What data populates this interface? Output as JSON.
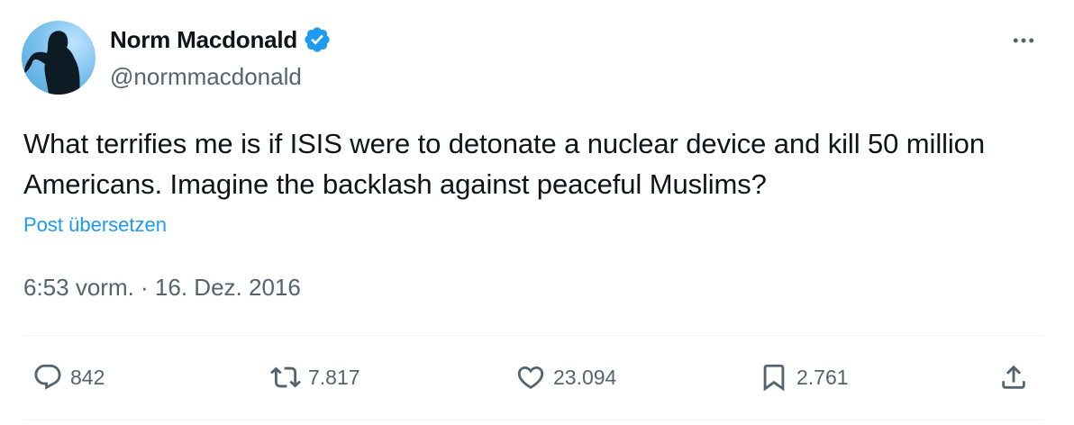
{
  "author": {
    "display_name": "Norm Macdonald",
    "handle": "@normmacdonald",
    "verified": true
  },
  "tweet": {
    "text": "What terrifies me is if ISIS were to detonate a nuclear device and kill 50 million Americans. Imagine the backlash against peaceful Muslims?",
    "translate_link": "Post übersetzen",
    "timestamp": "6:53 vorm. · 16. Dez. 2016"
  },
  "actions": {
    "replies": "842",
    "reposts": "7.817",
    "likes": "23.094",
    "bookmarks": "2.761"
  },
  "icons": {
    "more": "more-dots-icon",
    "reply": "reply-bubble-icon",
    "repost": "repost-arrows-icon",
    "like": "heart-icon",
    "bookmark": "bookmark-icon",
    "share": "share-upload-icon",
    "verified": "verified-badge-icon"
  },
  "colors": {
    "text": "#0f1419",
    "secondary": "#536471",
    "accent": "#1d9bf0",
    "divider": "#eff3f4"
  }
}
